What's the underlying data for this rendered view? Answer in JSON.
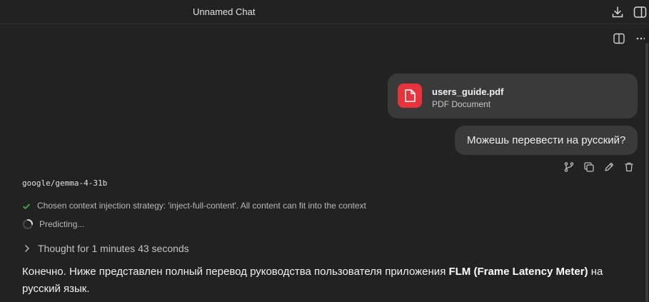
{
  "window": {
    "title": "Unnamed Chat"
  },
  "icons": {
    "download": "download-icon",
    "sidebar": "sidebar-toggle-icon",
    "split": "split-view-icon",
    "more": "more-icon",
    "file": "pdf-file-icon",
    "branch": "branch-icon",
    "copy": "copy-icon",
    "edit": "edit-icon",
    "delete": "delete-icon",
    "check": "check-icon",
    "spinner": "spinner-icon",
    "chevron": "chevron-right-icon"
  },
  "colors": {
    "background": "#222222",
    "bubble": "#3a3a3a",
    "file_icon": "#e8333c",
    "check": "#4caf50"
  },
  "attachment": {
    "name": "users_guide.pdf",
    "type": "PDF Document"
  },
  "user_message": {
    "text": "Можешь перевести на русский?"
  },
  "assistant": {
    "model": "google/gemma-4-31b",
    "context_status": "Chosen context injection strategy: 'inject-full-content'. All content can fit into the context",
    "predicting": "Predicting...",
    "thought": "Thought for 1 minutes 43 seconds",
    "answer_prefix": "Конечно. Ниже представлен полный перевод руководства пользователя приложения ",
    "answer_bold": "FLM (Frame Latency Meter)",
    "answer_suffix": " на русский язык."
  }
}
